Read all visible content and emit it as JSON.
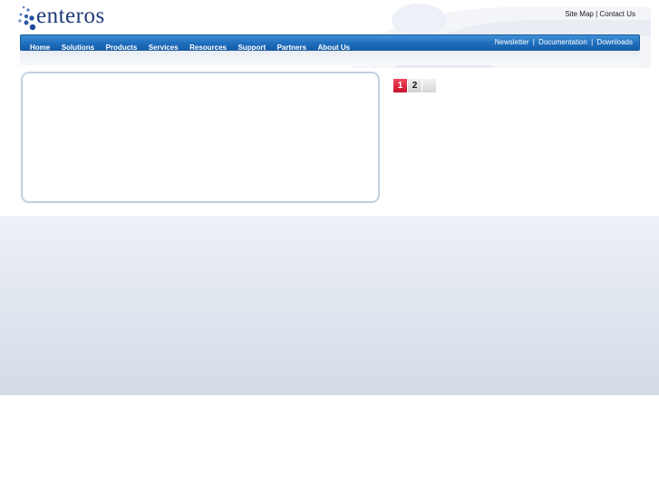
{
  "logo": {
    "text": "enteros"
  },
  "top_links": {
    "site_map": "Site Map",
    "separator": "|",
    "contact_us": "Contact Us"
  },
  "nav": {
    "items": [
      "Home",
      "Solutions",
      "Products",
      "Services",
      "Resources",
      "Support",
      "Partners",
      "About Us"
    ],
    "right_links": [
      "Newsletter",
      "Documentation",
      "Downloads"
    ],
    "separator": "|"
  },
  "pager": {
    "pages": [
      "1",
      "2",
      ""
    ],
    "active": "1"
  },
  "colors": {
    "nav_bar": "#1f6ebd",
    "logo_text": "#1d3a78",
    "active_page": "#d9203a",
    "panel_border": "#c3cfdf"
  }
}
